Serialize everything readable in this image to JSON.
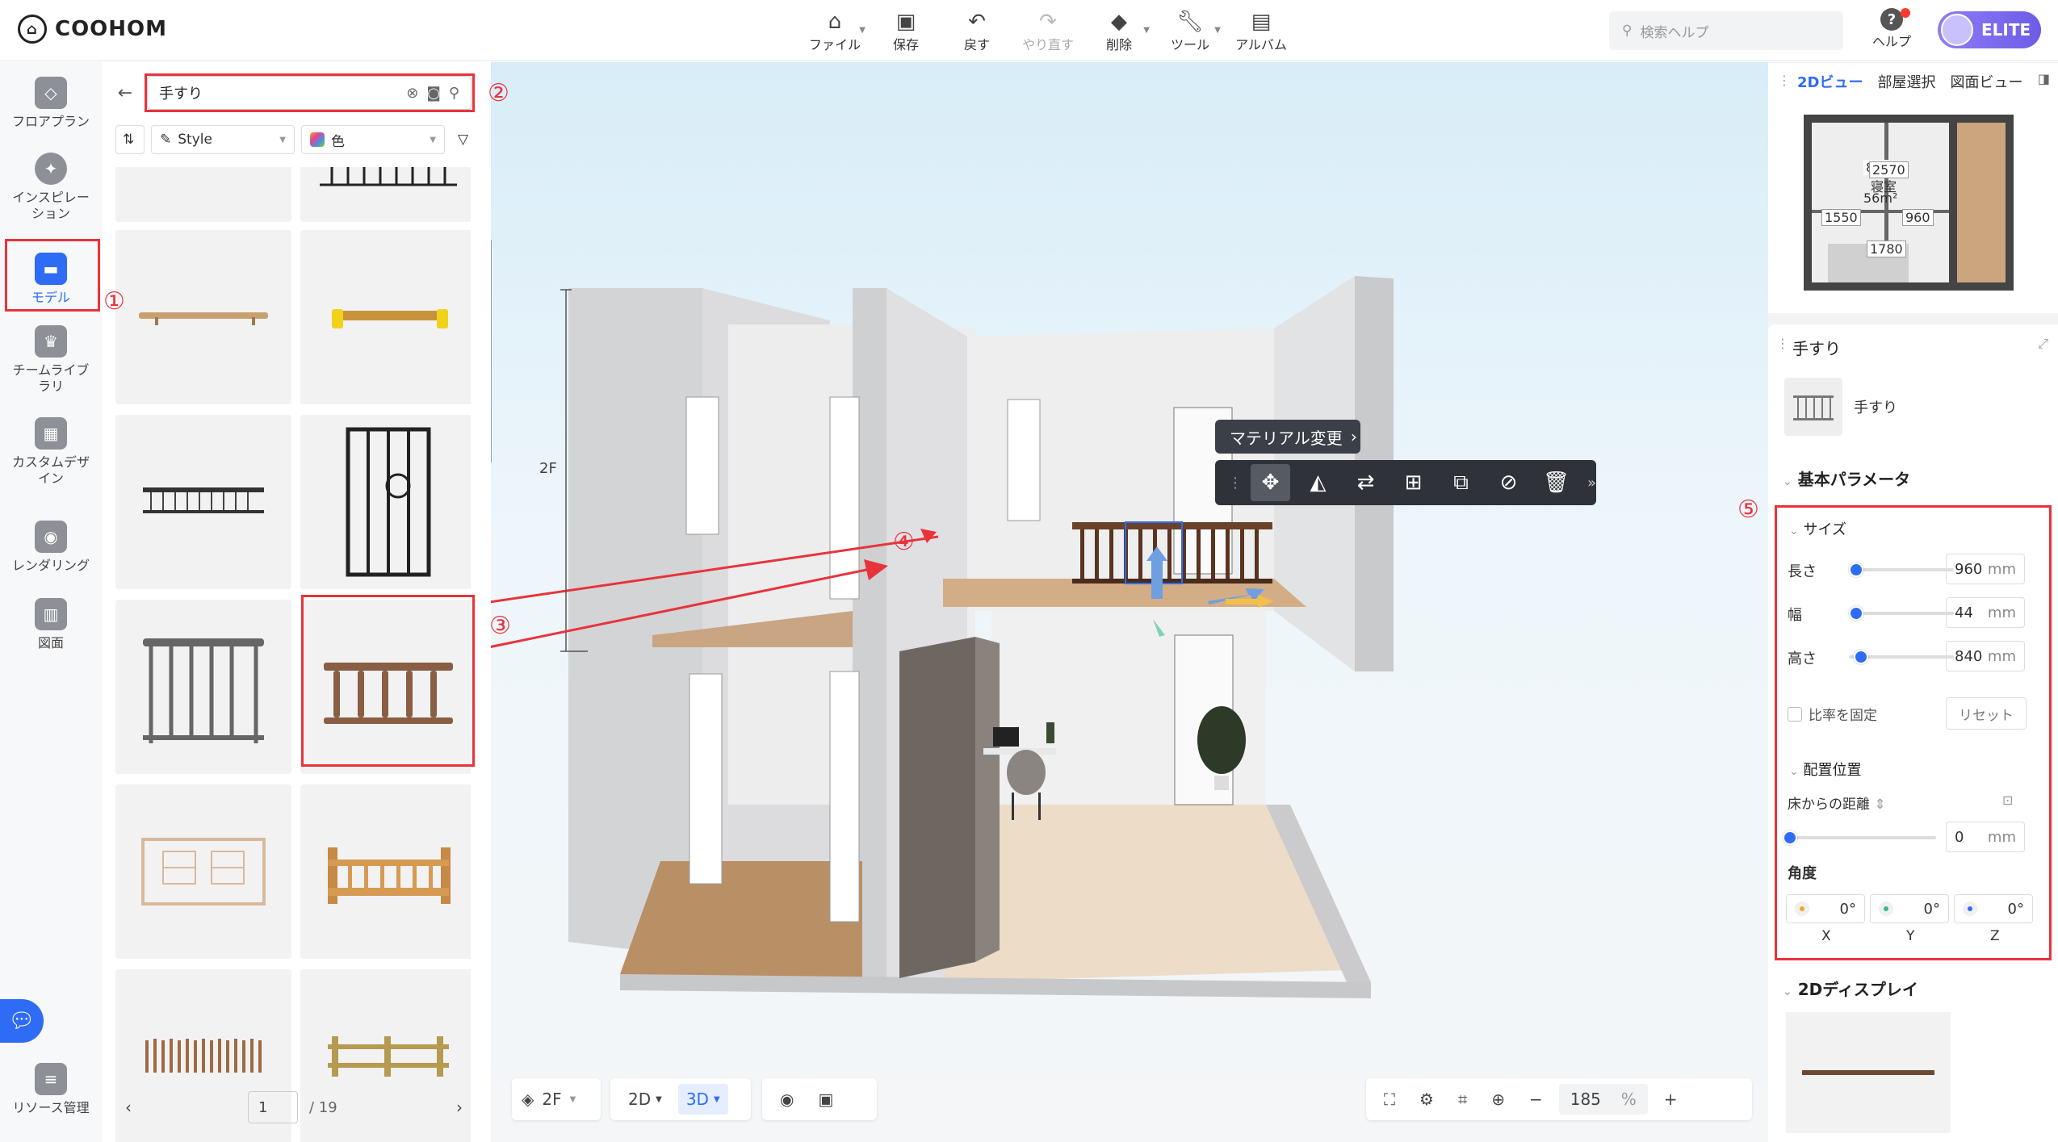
{
  "app": {
    "brand": "COOHOM"
  },
  "toolbar": {
    "file": "ファイル",
    "save": "保存",
    "undo": "戻す",
    "redo": "やり直す",
    "delete": "削除",
    "tools": "ツール",
    "album": "アルバム"
  },
  "header": {
    "search_placeholder": "検索ヘルプ",
    "help": "ヘルプ",
    "badge": "ELITE"
  },
  "rail": {
    "items": [
      {
        "label": "フロアプラン"
      },
      {
        "label": "インスピレーション"
      },
      {
        "label": "モデル"
      },
      {
        "label": "チームライブラリ"
      },
      {
        "label": "カスタムデザイン"
      },
      {
        "label": "レンダリング"
      },
      {
        "label": "図面"
      },
      {
        "label": "リソース管理"
      }
    ]
  },
  "annotations": {
    "n1": "①",
    "n2": "②",
    "n3": "③",
    "n4": "④",
    "n5": "⑤"
  },
  "panel": {
    "search_value": "手すり",
    "filter_style": "Style",
    "filter_color": "色",
    "page": "1",
    "total_pages": "/ 19"
  },
  "viewport": {
    "floor_label": "2F",
    "material_tip": "マテリアル変更",
    "floor_select": "2F",
    "view_2d": "2D",
    "view_3d": "3D",
    "zoom": "185",
    "zoom_unit": "%"
  },
  "minimap": {
    "tabs": [
      "2Dビュー",
      "部屋選択",
      "図面ビュー"
    ],
    "dims": [
      "2570",
      "1550",
      "960",
      "1780"
    ],
    "room_area": "8.0",
    "room_name": "寝室",
    "room_area2": "56m²"
  },
  "props": {
    "title": "手すり",
    "item_name": "手すり",
    "basic_params": "基本パラメータ",
    "size": "サイズ",
    "length_label": "長さ",
    "length": "960",
    "width_label": "幅",
    "width": "44",
    "height_label": "高さ",
    "height": "840",
    "unit": "mm",
    "lock_ratio": "比率を固定",
    "reset": "リセット",
    "placement": "配置位置",
    "floor_dist_label": "床からの距離",
    "floor_dist": "0",
    "angle_label": "角度",
    "angle_x": "0°",
    "angle_y": "0°",
    "angle_z": "0°",
    "axis_x": "X",
    "axis_y": "Y",
    "axis_z": "Z",
    "display_2d": "2Dディスプレイ"
  },
  "colors": {
    "accent": "#2f6cf6",
    "annotation": "#e8333b"
  }
}
